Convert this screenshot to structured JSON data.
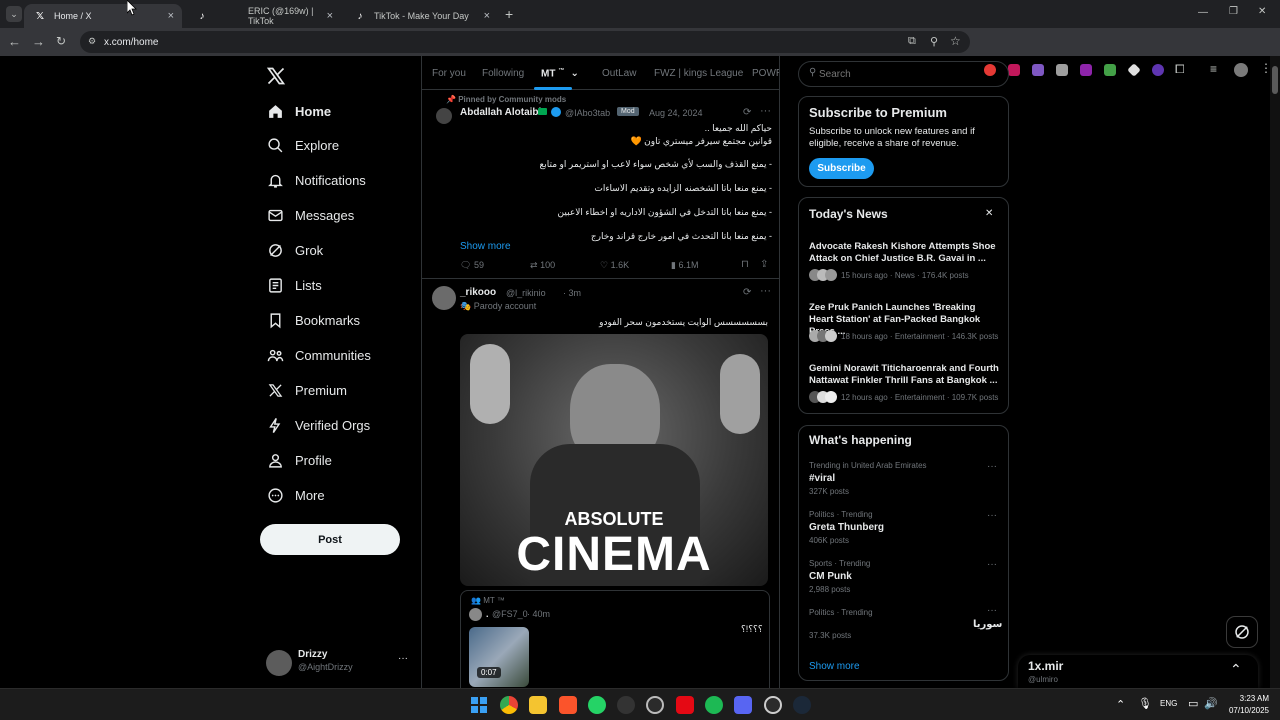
{
  "browser": {
    "tabs": [
      {
        "title": "Home / X",
        "active": true
      },
      {
        "title": "ERIC (@169w) | TikTok",
        "active": false
      },
      {
        "title": "TikTok - Make Your Day",
        "active": false
      }
    ],
    "url": "x.com/home",
    "new_tab": "+",
    "tab_close": "×",
    "window": {
      "minimize": "—",
      "maximize": "❐",
      "close": "✕"
    }
  },
  "sidebar": {
    "items": [
      {
        "label": "Home",
        "icon": "home-icon"
      },
      {
        "label": "Explore",
        "icon": "search-icon"
      },
      {
        "label": "Notifications",
        "icon": "bell-icon"
      },
      {
        "label": "Messages",
        "icon": "mail-icon"
      },
      {
        "label": "Grok",
        "icon": "grok-icon"
      },
      {
        "label": "Lists",
        "icon": "list-icon"
      },
      {
        "label": "Bookmarks",
        "icon": "bookmark-icon"
      },
      {
        "label": "Communities",
        "icon": "communities-icon"
      },
      {
        "label": "Premium",
        "icon": "x-logo-icon"
      },
      {
        "label": "Verified Orgs",
        "icon": "lightning-icon"
      },
      {
        "label": "Profile",
        "icon": "person-icon"
      },
      {
        "label": "More",
        "icon": "more-circle-icon"
      }
    ],
    "post_button": "Post",
    "account": {
      "name": "Drizzy",
      "handle": "@AightDrizzy",
      "more": "···"
    }
  },
  "feed": {
    "tabs": [
      "For you",
      "Following",
      "MT",
      "OutLaw",
      "FWZ | kings League",
      "POWR"
    ],
    "tab_badge": "™",
    "post1": {
      "pinned": "Pinned by Community mods",
      "name": "Abdallah Alotaibi",
      "handle": "@IAbo3tab",
      "role": "Mod",
      "date": "Aug 24, 2024",
      "lines": [
        "حياكم الله جميعا ..",
        "قوانين مجتمع سيرفر ميستري تاون 🧡",
        "- يمنع القذف والسب لأي شخص سواء لاعب او استريمر او متابع",
        "- يمنع منعا باتا الشخصنه الزايده وتقديم الاساءات",
        "- يمنع منعا باتا التدخل في الشؤون الاداريه او اخطاء الاعبين",
        "- يمنع منعا باتا التحدث في امور خارج قراند وخارج"
      ],
      "show_more": "Show more",
      "stats": {
        "replies": "59",
        "reposts": "100",
        "likes": "1.6K",
        "views": "6.1M"
      }
    },
    "post2": {
      "name": "_rikooo",
      "handle": "@l_rikinio",
      "time": "3m",
      "parody": "Parody account",
      "text": "بسسسسسس الوايت يستخدمون سحر الفودو",
      "image_caption_top": "ABSOLUTE",
      "image_caption_bottom": "CINEMA",
      "quote": {
        "community": "MT ™",
        "name": ".",
        "handle": "@FS7_0",
        "time": "40m",
        "text": "؟؟؟!؟",
        "video_time": "0:07"
      }
    }
  },
  "search": {
    "placeholder": "Search"
  },
  "premium": {
    "title": "Subscribe to Premium",
    "text": "Subscribe to unlock new features and if eligible, receive a share of revenue.",
    "button": "Subscribe"
  },
  "news": {
    "title": "Today's News",
    "close": "✕",
    "items": [
      {
        "title": "Advocate Rakesh Kishore Attempts Shoe Attack on Chief Justice B.R. Gavai in ...",
        "meta": "15 hours ago · News · 176.4K posts"
      },
      {
        "title": "Zee Pruk Panich Launches 'Breaking Heart Station' at Fan-Packed Bangkok Press ...",
        "meta": "18 hours ago · Entertainment · 146.3K posts"
      },
      {
        "title": "Gemini Norawit Titicharoenrak and Fourth Nattawat Finkler Thrill Fans at Bangkok ...",
        "meta": "12 hours ago · Entertainment · 109.7K posts"
      }
    ]
  },
  "trends": {
    "title": "What's happening",
    "items": [
      {
        "context": "Trending in United Arab Emirates",
        "name": "#viral",
        "posts": "327K posts"
      },
      {
        "context": "Politics · Trending",
        "name": "Greta Thunberg",
        "posts": "406K posts"
      },
      {
        "context": "Sports · Trending",
        "name": "CM Punk",
        "posts": "2,988 posts"
      },
      {
        "context": "Politics · Trending",
        "name": "سوريا",
        "posts": "37.3K posts"
      }
    ],
    "more": "···",
    "show_more": "Show more"
  },
  "messages_drawer": {
    "name": "1x.mir",
    "handle": "@ulmiro"
  },
  "taskbar": {
    "lang": "ENG",
    "time": "3:23 AM",
    "date": "07/10/2025"
  }
}
